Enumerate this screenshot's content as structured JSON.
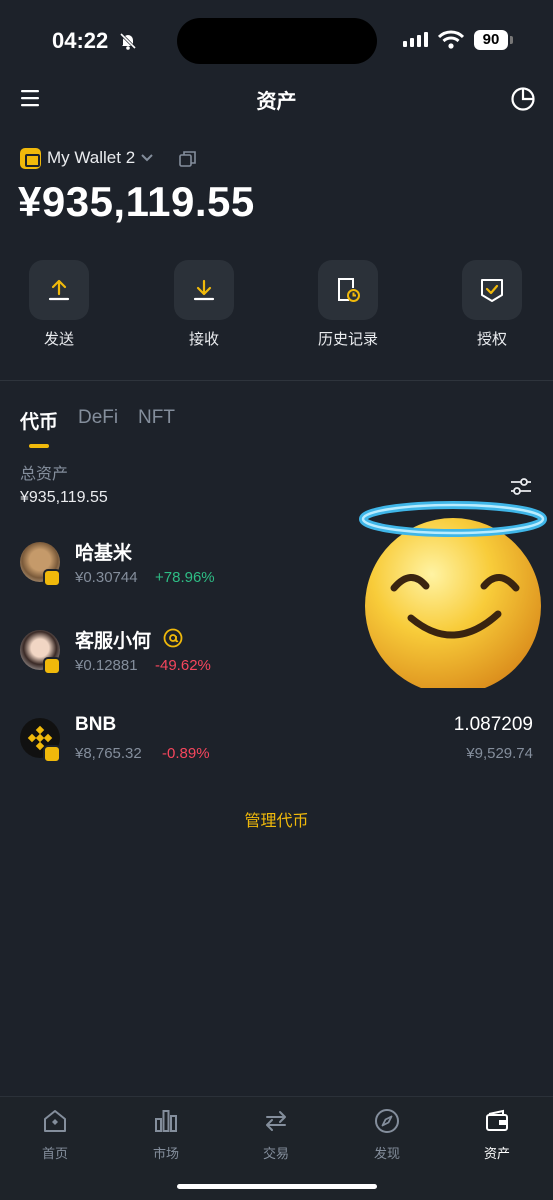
{
  "status_bar": {
    "time": "04:22",
    "battery": "90"
  },
  "header": {
    "title": "资产"
  },
  "wallet": {
    "name": "My Wallet 2",
    "balance": "¥935,119.55"
  },
  "actions": [
    {
      "label": "发送",
      "icon": "upload-icon"
    },
    {
      "label": "接收",
      "icon": "download-icon"
    },
    {
      "label": "历史记录",
      "icon": "history-icon"
    },
    {
      "label": "授权",
      "icon": "approval-icon"
    }
  ],
  "tabs": [
    {
      "label": "代币",
      "active": true
    },
    {
      "label": "DeFi",
      "active": false
    },
    {
      "label": "NFT",
      "active": false
    }
  ],
  "summary": {
    "label": "总资产",
    "value": "¥935,119.55"
  },
  "tokens": [
    {
      "name": "哈基米",
      "price": "¥0.30744",
      "change": "+78.96%",
      "direction": "up",
      "amount": "",
      "value": ""
    },
    {
      "name": "客服小何",
      "price": "¥0.12881",
      "change": "-49.62%",
      "direction": "down",
      "amount": "",
      "value": ""
    },
    {
      "name": "BNB",
      "price": "¥8,765.32",
      "change": "-0.89%",
      "direction": "down",
      "amount": "1.087209",
      "value": "¥9,529.74"
    }
  ],
  "manage_label": "管理代币",
  "nav": [
    {
      "label": "首页",
      "icon": "home-icon",
      "active": false
    },
    {
      "label": "市场",
      "icon": "market-icon",
      "active": false
    },
    {
      "label": "交易",
      "icon": "trade-icon",
      "active": false
    },
    {
      "label": "发现",
      "icon": "discover-icon",
      "active": false
    },
    {
      "label": "资产",
      "icon": "wallet-icon",
      "active": true
    }
  ],
  "colors": {
    "accent": "#f0b90b",
    "up": "#2ebd85",
    "down": "#f6465d",
    "background": "#1d222a"
  }
}
